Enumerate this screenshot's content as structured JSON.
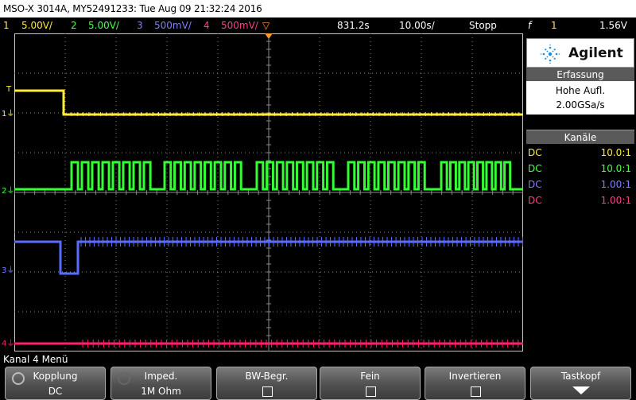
{
  "title_bar": {
    "text": "MSO-X 3014A, MY52491233: Tue Aug 09 21:32:24 2016"
  },
  "status_bar": {
    "ch1_num": "1",
    "ch1_scale": "5.00V/",
    "ch2_num": "2",
    "ch2_scale": "5.00V/",
    "ch3_num": "3",
    "ch3_scale": "500mV/",
    "ch4_num": "4",
    "ch4_scale": "500mV/",
    "time_offset": "831.2s",
    "time_scale": "10.00s/",
    "run_state": "Stopp",
    "trigger_symbol": "f",
    "trigger_channel": "1",
    "trigger_level": "1.56V"
  },
  "colors": {
    "ch1": "#ffeb3b",
    "ch2": "#33ff33",
    "ch3": "#5a6cff",
    "ch4": "#ff1f6e",
    "grid_dots": "#8a8a8a",
    "grid_frame": "#c8c8c8",
    "trigger_marker": "#ff9a2e"
  },
  "markers": {
    "trig_label": "T",
    "ch1_label": "1",
    "ch2_label": "2",
    "ch3_label": "3",
    "ch4_label": "4"
  },
  "panel": {
    "brand": "Agilent",
    "acquisition_header": "Erfassung",
    "acq_mode": "Hohe Aufl.",
    "sample_rate": "2.00GSa/s",
    "channels_header": "Kanäle",
    "channels": [
      {
        "coupling": "DC",
        "ratio": "10.0:1"
      },
      {
        "coupling": "DC",
        "ratio": "10.0:1"
      },
      {
        "coupling": "DC",
        "ratio": "1.00:1"
      },
      {
        "coupling": "DC",
        "ratio": "1.00:1"
      }
    ]
  },
  "menu": {
    "title": "Kanal 4 Menü",
    "softkeys": [
      {
        "label": "Kopplung",
        "value": "DC",
        "icon": "rotary-knob-icon"
      },
      {
        "label": "Imped.",
        "value": "1M Ohm",
        "icon": "rotary-knob-icon"
      },
      {
        "label": "BW-Begr.",
        "checked": false
      },
      {
        "label": "Fein",
        "checked": false
      },
      {
        "label": "Invertieren",
        "checked": false
      },
      {
        "label": "Tastkopf",
        "icon": "down-arrow-icon"
      }
    ]
  },
  "waveform_levels": {
    "ch1_high_fraction": 0.18,
    "ch1_low_fraction": 0.255,
    "ch2_low_fraction": 0.49,
    "ch2_high_fraction": 0.405,
    "ch3_base_fraction": 0.655,
    "ch3_dip_fraction": 0.755,
    "ch4_base_fraction": 0.975
  }
}
